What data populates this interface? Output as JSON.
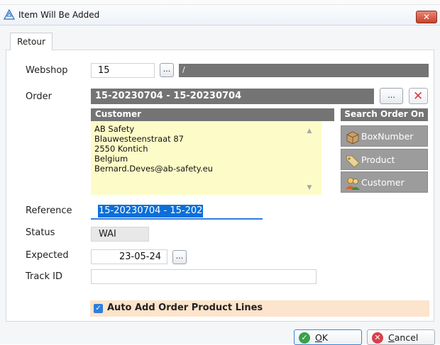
{
  "window": {
    "title": "Item Will Be Added",
    "close_glyph": "✕"
  },
  "tabs": [
    {
      "label": "Retour"
    }
  ],
  "webshop": {
    "label": "Webshop",
    "id": "15",
    "ellipsis": "...",
    "name": "/"
  },
  "order": {
    "label": "Order",
    "value": "15-20230704 - 15-20230704",
    "ellipsis": "...",
    "clear_glyph": "✕"
  },
  "customer": {
    "header": "Customer",
    "lines": "AB Safety\nBlauwesteenstraat 87\n2550 Kontich\nBelgium\nBernard.Deves@ab-safety.eu"
  },
  "search_order_on": {
    "header": "Search Order On",
    "buttons": [
      {
        "label": "BoxNumber",
        "icon": "box-icon"
      },
      {
        "label": "Product",
        "icon": "tag-icon"
      },
      {
        "label": "Customer",
        "icon": "people-icon"
      }
    ]
  },
  "reference": {
    "label": "Reference",
    "value": "15-20230704 - 15-202"
  },
  "status": {
    "label": "Status",
    "value": "WAI"
  },
  "expected": {
    "label": "Expected",
    "value": "23-05-24",
    "ellipsis": "..."
  },
  "track_id": {
    "label": "Track ID",
    "value": ""
  },
  "auto_add": {
    "label": "Auto Add Order Product Lines",
    "checked": true
  },
  "footer": {
    "ok": {
      "label": "OK",
      "accel": "O",
      "rest": "K"
    },
    "cancel": {
      "label": "Cancel",
      "accel": "C",
      "rest": "ancel"
    }
  },
  "colors": {
    "grey_bar": "#747474",
    "memo_bg": "#fdfcc8",
    "auto_row_bg": "#fde4cc",
    "accent": "#2e7ee0",
    "close": "#c7432c"
  }
}
